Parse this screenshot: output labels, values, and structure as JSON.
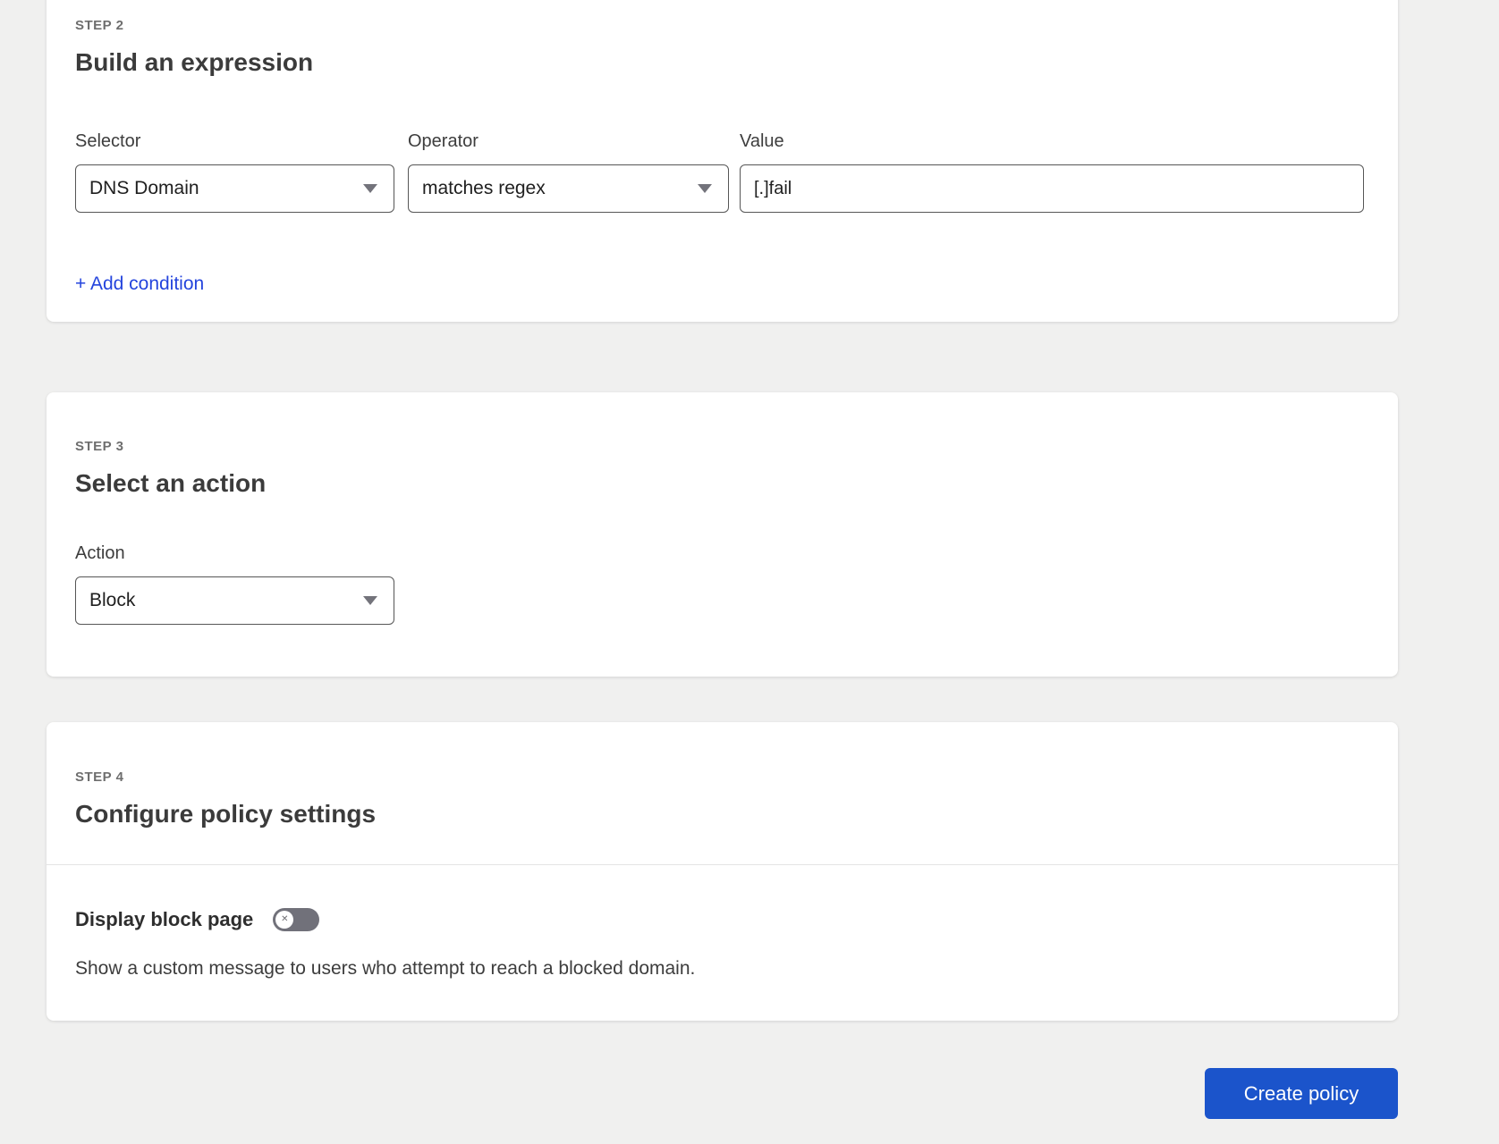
{
  "colors": {
    "page_background": "#f0f0ef",
    "link_blue": "#2444dd",
    "button_blue": "#1b54cb",
    "toggle_off_gray": "#71717a",
    "divider_gray": "#e4e4e4"
  },
  "icons": {
    "toggle_off_glyph": "✕"
  },
  "step2": {
    "step_label": "STEP 2",
    "title": "Build an expression",
    "selector": {
      "label": "Selector",
      "value": "DNS Domain"
    },
    "operator": {
      "label": "Operator",
      "value": "matches regex"
    },
    "value": {
      "label": "Value",
      "value": "[.]fail"
    },
    "add_condition": "+ Add condition"
  },
  "step3": {
    "step_label": "STEP 3",
    "title": "Select an action",
    "action": {
      "label": "Action",
      "value": "Block"
    }
  },
  "step4": {
    "step_label": "STEP 4",
    "title": "Configure policy settings",
    "display_block_page": {
      "label": "Display block page",
      "toggle_state": "off",
      "description": "Show a custom message to users who attempt to reach a blocked domain."
    }
  },
  "footer": {
    "create_policy": "Create policy"
  }
}
